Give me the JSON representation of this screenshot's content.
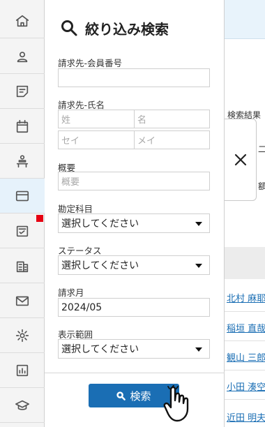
{
  "rail": {
    "items": [
      {
        "icon": "home-icon"
      },
      {
        "icon": "user-icon"
      },
      {
        "icon": "document-icon"
      },
      {
        "icon": "calendar-icon"
      },
      {
        "icon": "reception-icon"
      },
      {
        "icon": "credit-card-icon",
        "active": true
      },
      {
        "icon": "checklist-icon",
        "badge": true
      },
      {
        "icon": "building-icon"
      },
      {
        "icon": "mail-icon"
      },
      {
        "icon": "gear-icon"
      },
      {
        "icon": "report-icon"
      },
      {
        "icon": "graduation-cap-icon"
      }
    ],
    "badge_color": "#e60012",
    "active_color": "#e6f2fb"
  },
  "panel": {
    "title": "絞り込み検索",
    "fields": {
      "member_no_label": "請求先-会員番号",
      "member_no_value": "",
      "name_label": "請求先-氏名",
      "last_name_placeholder": "姓",
      "first_name_placeholder": "名",
      "last_kana_placeholder": "セイ",
      "first_kana_placeholder": "メイ",
      "summary_label": "概要",
      "summary_placeholder": "概要",
      "account_label": "勘定科目",
      "account_value": "選択してください",
      "status_label": "ステータス",
      "status_value": "選択してください",
      "month_label": "請求月",
      "month_value": "2024/05",
      "range_label": "表示範囲",
      "range_value": "選択してください"
    },
    "search_button": "検索",
    "accent_color": "#1a6eb4"
  },
  "background": {
    "result_label": "検索結果",
    "fragment_1": "二対",
    "fragment_2": "額:",
    "links": [
      "北村 麻耶",
      "稲垣 直哉",
      "観山 三郎",
      "小田 湊空",
      "近田 明夫"
    ]
  }
}
